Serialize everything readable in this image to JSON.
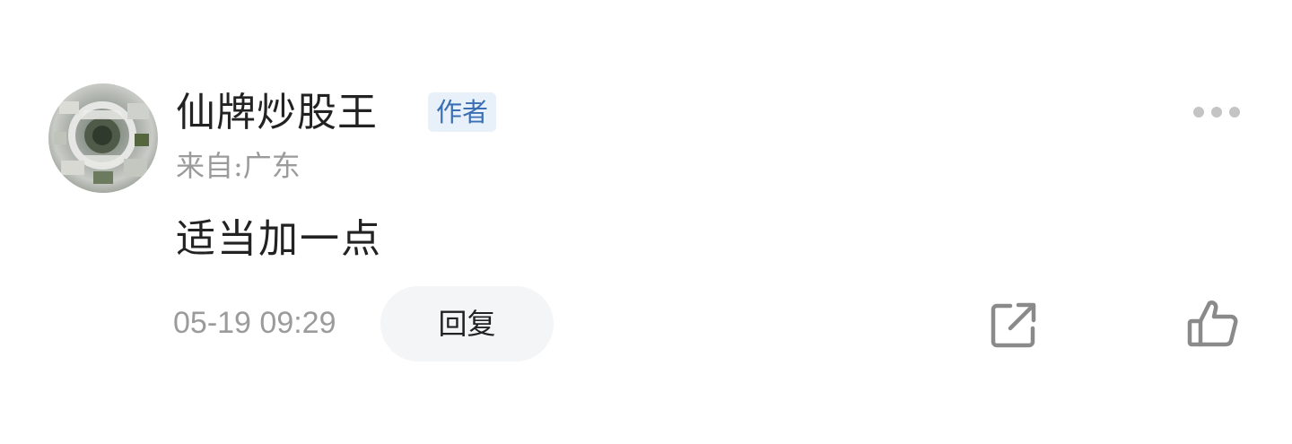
{
  "comment": {
    "username": "仙牌炒股王",
    "author_badge": "作者",
    "location": "来自:广东",
    "text": "适当加一点",
    "timestamp": "05-19 09:29",
    "reply_label": "回复"
  },
  "icons": {
    "more": "more-dots-icon",
    "share": "share-external-icon",
    "like": "thumbs-up-icon"
  },
  "colors": {
    "badge_bg": "#e8f0fa",
    "badge_text": "#3a6fb5",
    "muted_text": "#9b9b9b",
    "primary_text": "#222222",
    "icon_gray": "#8a8a8a"
  }
}
